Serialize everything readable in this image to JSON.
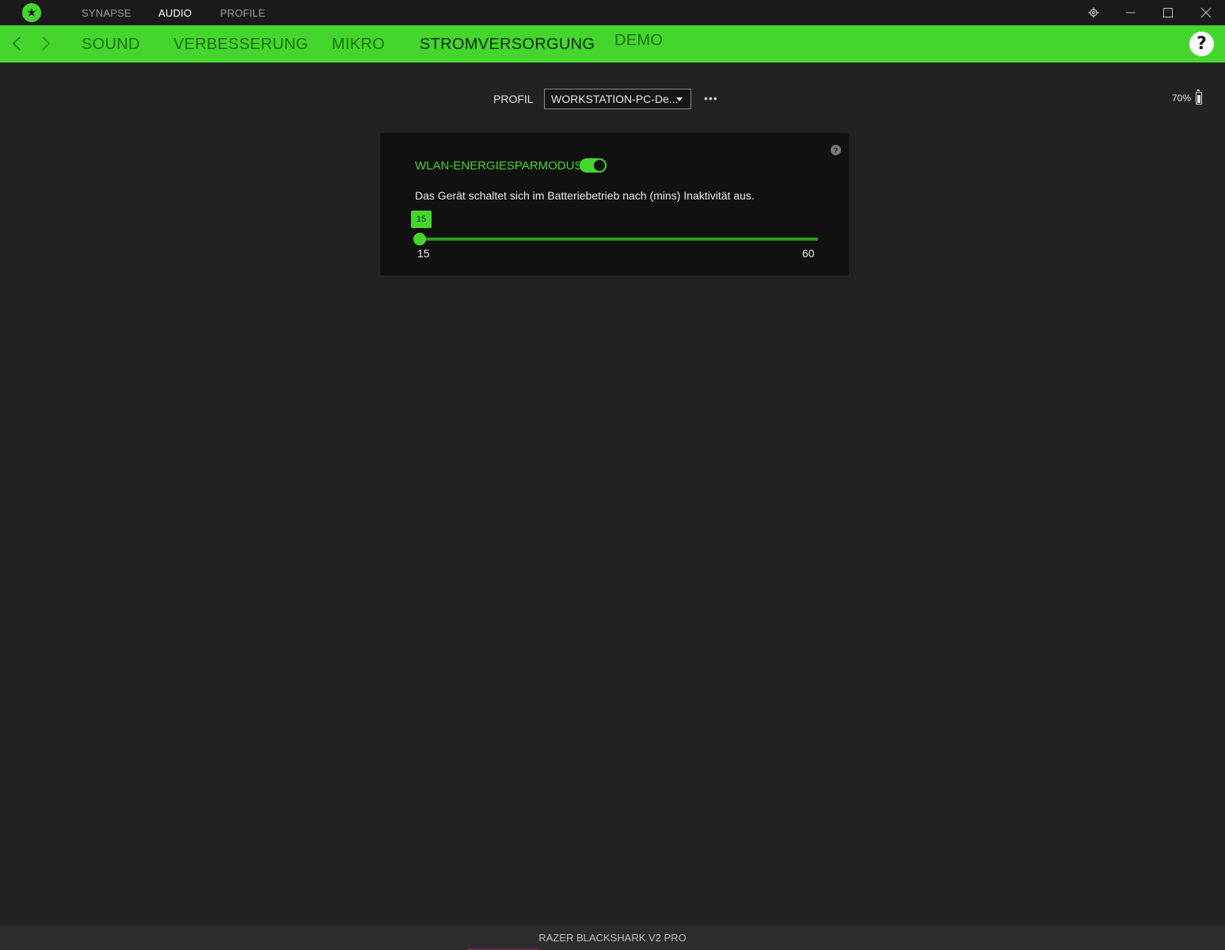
{
  "titlebar": {
    "tabs": [
      {
        "label": "SYNAPSE",
        "active": false
      },
      {
        "label": "AUDIO",
        "active": true
      },
      {
        "label": "PROFILE",
        "active": false
      }
    ],
    "icons": [
      "settings-gear-icon",
      "minimize-icon",
      "maximize-icon",
      "close-icon"
    ]
  },
  "subnav": {
    "tabs": [
      {
        "label": "SOUND",
        "active": false
      },
      {
        "label": "VERBESSERUNG",
        "active": false
      },
      {
        "label": "MIKRO",
        "active": false
      },
      {
        "label": "STROMVERSORGUNG",
        "active": true
      },
      {
        "label": "DEMO",
        "active": false
      }
    ],
    "help_label": "?"
  },
  "profile": {
    "label": "PROFIL",
    "selected": "WORKSTATION-PC-De...",
    "more_label": "•••"
  },
  "battery": {
    "percent_label": "70%",
    "level": 0.7
  },
  "power_card": {
    "title": "WLAN-ENERGIESPARMODUS",
    "toggle_on": true,
    "description": "Das Gerät schaltet sich im Batteriebetrieb nach (mins) Inaktivität aus.",
    "slider": {
      "value": 15,
      "value_label": "15",
      "min": 15,
      "max": 60,
      "min_label": "15",
      "max_label": "60"
    },
    "help_label": "?"
  },
  "footer": {
    "device_name": "RAZER BLACKSHARK V2 PRO"
  },
  "colors": {
    "accent": "#44d62c",
    "background": "#222222",
    "card": "#111111"
  }
}
